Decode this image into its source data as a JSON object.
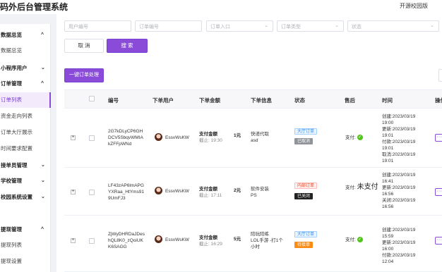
{
  "app": {
    "title": "码外后台管理系统",
    "top_link": "开源校园版"
  },
  "sidebar": {
    "groups": [
      {
        "label": "数据总览",
        "items": [
          "数据总览"
        ]
      },
      {
        "label": "小程序用户",
        "items": []
      },
      {
        "label": "订单管理",
        "items": [
          "订单列表",
          "资金走向列表",
          "订单大厅展示",
          "时间要求配置"
        ]
      },
      {
        "label": "接单员管理",
        "items": []
      },
      {
        "label": "学校管理",
        "items": []
      },
      {
        "label": "校园系统设置",
        "items": []
      },
      {
        "label": "提现管理",
        "items": [
          "提现列表",
          "提现设置"
        ]
      }
    ],
    "active_item": "订单列表"
  },
  "filters": {
    "user_no": "用户编号",
    "order_no": "订单编号",
    "entry": "订单入口",
    "type": "订单类型",
    "status": "状态"
  },
  "buttons": {
    "cancel": "取 消",
    "search": "搜 索",
    "batch": "一键订单处理"
  },
  "table": {
    "columns": [
      "编号",
      "下单用户",
      "下单金额",
      "下单信息",
      "状态",
      "售后",
      "时间",
      "操作"
    ],
    "rows": [
      {
        "id_lines": [
          "2G7kDLyCP6GH",
          "DCV5SbqvWMIA",
          "kZFFpWNd"
        ],
        "user": "EssvWsKW",
        "amount_label": "支付金额",
        "amount_value": "1元",
        "deadline": "截止: 19:30",
        "info_lines": [
          "快递代取",
          "asd"
        ],
        "tags": [
          {
            "text": "大厅订单",
            "color": "blue"
          },
          {
            "text": "已取消",
            "color": "grey"
          }
        ],
        "aftersale_label": "支付:",
        "aftersale_extra": "",
        "time_lines": [
          "创建:2023/03/19",
          "19:00",
          "更新:2023/03/19",
          "19:01",
          "付款:2023/03/19",
          "19:01",
          "取消:2023/03/19",
          "19:01"
        ]
      },
      {
        "id_lines": [
          "LF43zAP6lmAPG",
          "YXRaa_HtYms91",
          "9UmFJ3"
        ],
        "user": "EssvWsKW",
        "amount_label": "支付金额",
        "amount_value": "2元",
        "deadline": "截止: 17:11",
        "info_lines": [
          "软件安装",
          "PS"
        ],
        "tags": [
          {
            "text": "内部订单",
            "color": "red"
          },
          {
            "text": "已关闭",
            "color": "black"
          }
        ],
        "aftersale_label": "支付:",
        "aftersale_extra": "未支付",
        "time_lines": [
          "创建:2023/03/19",
          "16:41",
          "更新:2023/03/19",
          "16:56",
          "关闭:2023/03/19",
          "16:56"
        ]
      },
      {
        "id_lines": [
          "ZjWyDHRDaJDes",
          "hQL8K0_zQoiUK",
          "K6SAGG"
        ],
        "user": "EssvWsKW",
        "amount_label": "支付金额",
        "amount_value": "5元",
        "deadline": "截止: 16:29",
        "info_lines": [
          "陪玩陪练",
          "LOL手游 -打1个",
          "小时"
        ],
        "tags": [
          {
            "text": "大厅订单",
            "color": "blue"
          },
          {
            "text": "待接单",
            "color": "orange"
          }
        ],
        "aftersale_label": "支付:",
        "aftersale_extra": "",
        "time_lines": [
          "创建:2023/03/19",
          "15:59",
          "更新:2023/03/19",
          "16:00",
          "付款:2023/03/19",
          "12:04"
        ]
      }
    ]
  },
  "colors": {
    "accent": "#8a4bd8",
    "success": "#52c41a"
  }
}
